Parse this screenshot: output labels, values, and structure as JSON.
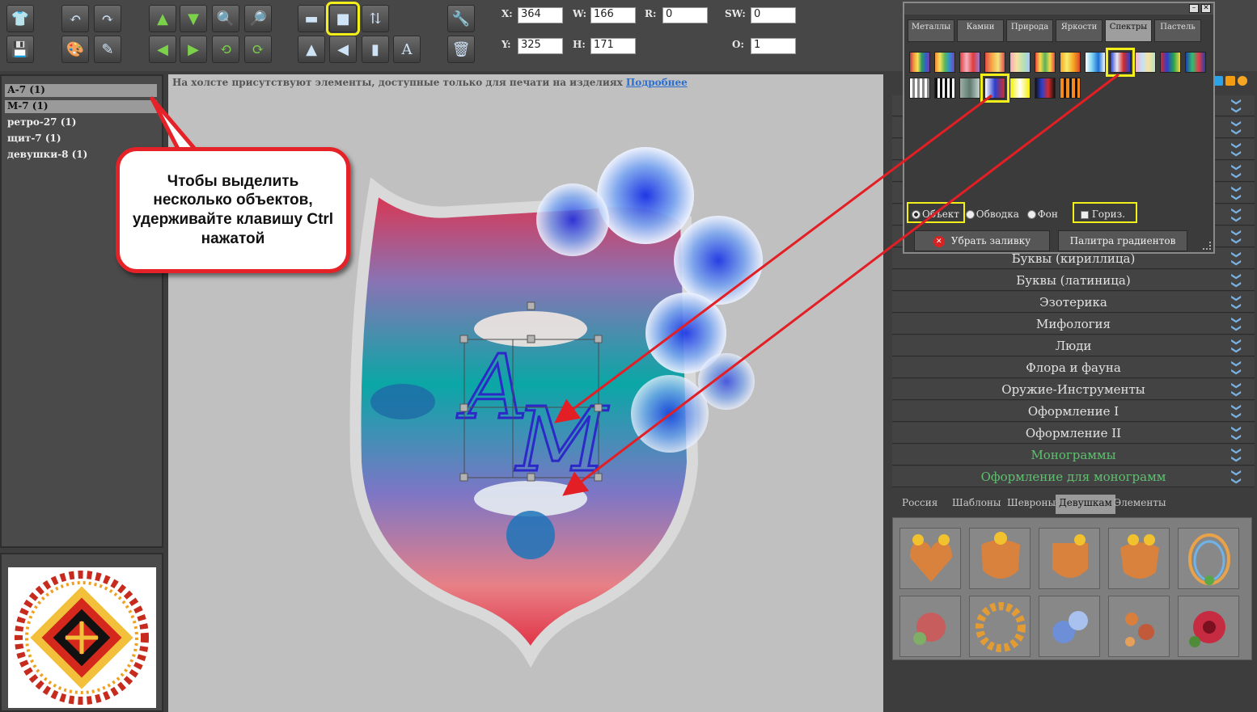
{
  "coords": {
    "x_label": "X:",
    "x_value": "364",
    "w_label": "W:",
    "w_value": "166",
    "r_label": "R:",
    "r_value": "0",
    "sw_label": "SW:",
    "sw_value": "0",
    "y_label": "Y:",
    "y_value": "325",
    "h_label": "H:",
    "h_value": "171",
    "o_label": "O:",
    "o_value": "1"
  },
  "objects": [
    "А-7 (1)",
    "М-7 (1)",
    "ретро-27 (1)",
    "щит-7 (1)",
    "девушки-8 (1)"
  ],
  "callout_text": "Чтобы выделить несколько объектов, удерживайте клавишу Ctrl нажатой",
  "canvas_note": {
    "text": "На холсте присутствуют элементы, доступные только для печати на изделиях",
    "link": "Подробнее"
  },
  "gradient_popup": {
    "tabs": [
      "Металлы",
      "Камни",
      "Природа",
      "Яркости",
      "Спектры",
      "Пастель"
    ],
    "active_tab": "Спектры",
    "radios": [
      "Объект",
      "Обводка",
      "Фон"
    ],
    "horizontal": "Гориз.",
    "remove_fill": "Убрать заливку",
    "gradient_palette": "Палитра градиентов"
  },
  "categories": [
    {
      "label": "",
      "green": false
    },
    {
      "label": "",
      "green": false
    },
    {
      "label": "",
      "green": false
    },
    {
      "label": "",
      "green": false
    },
    {
      "label": "",
      "green": false
    },
    {
      "label": "",
      "green": false
    },
    {
      "label": "",
      "green": false
    },
    {
      "label": "Буквы (кириллица)",
      "green": false
    },
    {
      "label": "Буквы (латиница)",
      "green": false
    },
    {
      "label": "Эзотерика",
      "green": false
    },
    {
      "label": "Мифология",
      "green": false
    },
    {
      "label": "Люди",
      "green": false
    },
    {
      "label": "Флора и фауна",
      "green": false
    },
    {
      "label": "Оружие-Инструменты",
      "green": false
    },
    {
      "label": "Оформление I",
      "green": false
    },
    {
      "label": "Оформление II",
      "green": false
    },
    {
      "label": "Монограммы",
      "green": true
    },
    {
      "label": "Оформление для монограмм",
      "green": true
    }
  ],
  "bottom_tabs": [
    "Россия",
    "Шаблоны",
    "Шевроны",
    "Девушкам",
    "Элементы"
  ],
  "active_bottom_tab": "Девушкам",
  "colors": {
    "accent_yellow": "#f2ef1a",
    "callout_red": "#e52227",
    "arrow_red": "#e31e24",
    "link_blue": "#2a6fd0",
    "monogram_green": "#5ec06f"
  }
}
